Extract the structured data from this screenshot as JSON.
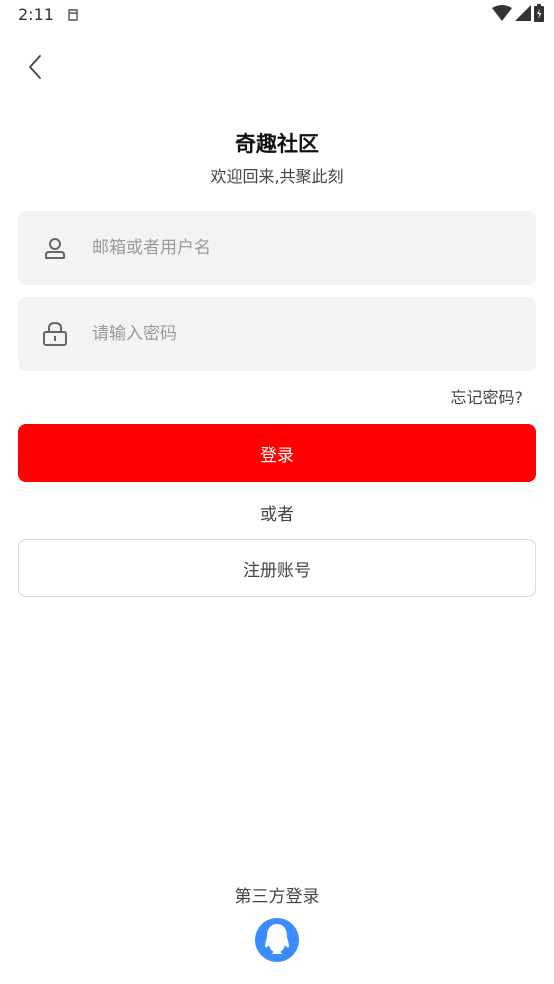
{
  "status_bar": {
    "time": "2:11",
    "icons": [
      "notification-icon",
      "wifi-icon",
      "signal-icon",
      "battery-icon"
    ]
  },
  "header": {
    "back_icon": "chevron-left-icon",
    "title": "奇趣社区",
    "subtitle": "欢迎回来,共聚此刻"
  },
  "form": {
    "username": {
      "placeholder": "邮箱或者用户名",
      "value": "",
      "icon": "user-icon"
    },
    "password": {
      "placeholder": "请输入密码",
      "value": "",
      "icon": "lock-icon"
    },
    "forgot_label": "忘记密码?",
    "login_label": "登录",
    "or_label": "或者",
    "register_label": "注册账号"
  },
  "third_party": {
    "label": "第三方登录",
    "providers": [
      {
        "icon": "qq-icon"
      }
    ]
  },
  "colors": {
    "accent": "#ff0000",
    "field_bg": "#f3f3f3",
    "qq_blue": "#3b8cff"
  }
}
